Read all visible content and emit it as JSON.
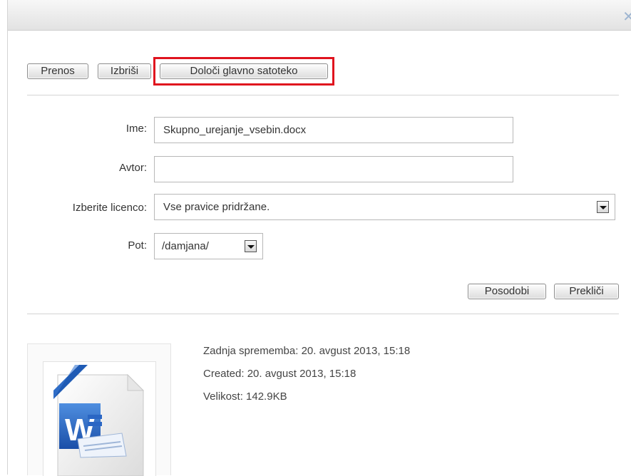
{
  "toolbar": {
    "download_label": "Prenos",
    "delete_label": "Izbriši",
    "set_main_label": "Določi glavno satoteko"
  },
  "form": {
    "name_label": "Ime:",
    "name_value": "Skupno_urejanje_vsebin.docx",
    "author_label": "Avtor:",
    "author_value": "",
    "license_label": "Izberite licenco:",
    "license_value": "Vse pravice pridržane.",
    "path_label": "Pot:",
    "path_value": "/damjana/"
  },
  "actions": {
    "update_label": "Posodobi",
    "cancel_label": "Prekliči"
  },
  "file_info": {
    "modified": "Zadnja sprememba: 20. avgust 2013, 15:18",
    "created": "Created: 20. avgust 2013, 15:18",
    "size": "Velikost: 142.9KB"
  },
  "icons": {
    "close": "close-icon",
    "file_thumbnail": "word-document-icon",
    "dropdown": "chevron-down-icon"
  },
  "colors": {
    "highlight": "#e0141e",
    "word_blue": "#1f5bb5"
  }
}
